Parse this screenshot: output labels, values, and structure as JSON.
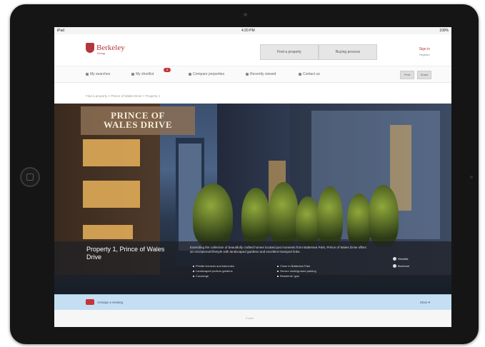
{
  "status_bar": {
    "left": "iPad",
    "time": "4:20 PM",
    "right": "100%"
  },
  "header": {
    "brand": "Berkeley",
    "brand_sub": "Group",
    "tabs": [
      "Find a property",
      "Buying process"
    ],
    "signin": "Sign in",
    "signin_sub": "Register"
  },
  "nav": {
    "items": [
      "My searches",
      "My shortlist",
      "Compare properties",
      "Recently viewed",
      "Contact us"
    ],
    "badge": "3",
    "buttons": [
      "Print",
      "Share"
    ]
  },
  "breadcrumb": "Find a property > Prince of Wales Drive > Property 1",
  "hero": {
    "title_line1": "PRINCE OF",
    "title_line2": "WALES DRIVE",
    "property_title": "Property 1, Prince of Wales Drive",
    "description": "Extending the collection of beautifully crafted homes located just moments from Battersea Park, Prince of Wales Drive offers an exceptional lifestyle with landscaped gardens and excellent transport links.",
    "features_left": [
      "Private terraces and balconies",
      "Landscaped podium gardens",
      "Concierge"
    ],
    "features_right": [
      "Close to Battersea Park",
      "Secure underground parking",
      "Residents' gym"
    ],
    "actions": [
      "Shortlist",
      "Brochure"
    ]
  },
  "bottom_bar": {
    "text": "Arrange a viewing",
    "right": "More ▾"
  },
  "footer": {
    "text": "Footer"
  }
}
